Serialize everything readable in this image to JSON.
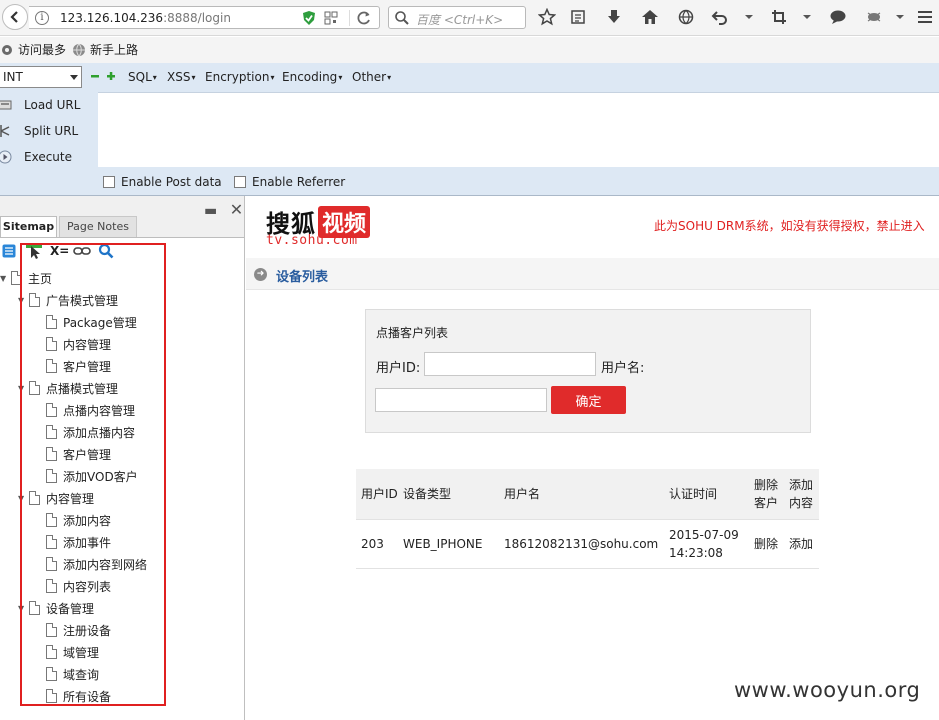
{
  "browser": {
    "url_host": "123.126.104.236",
    "url_tail": ":8888/login",
    "search_placeholder": "百度 <Ctrl+K>",
    "toolbar_icons": [
      "star-icon",
      "reading-list-icon",
      "download-icon",
      "home-icon",
      "web-icon",
      "undo-icon",
      "crop-icon",
      "chat-icon",
      "bug-icon"
    ]
  },
  "bookmarks": [
    {
      "label": "访问最多",
      "icon": "gear-icon"
    },
    {
      "label": "新手上路",
      "icon": "globe-icon"
    }
  ],
  "hackbar": {
    "select_value": "INT",
    "menus": [
      "SQL",
      "XSS",
      "Encryption",
      "Encoding",
      "Other"
    ],
    "actions": [
      "Load URL",
      "Split URL",
      "Execute"
    ],
    "options": [
      "Enable Post data",
      "Enable Referrer"
    ]
  },
  "sitemap": {
    "tabs": [
      "Sitemap",
      "Page Notes"
    ],
    "toolbar_xeq": "X=",
    "tree": [
      {
        "label": "主页",
        "level": 0,
        "expandable": true
      },
      {
        "label": "广告模式管理",
        "level": 1,
        "expandable": true
      },
      {
        "label": "Package管理",
        "level": 2,
        "expandable": false
      },
      {
        "label": "内容管理",
        "level": 2,
        "expandable": false
      },
      {
        "label": "客户管理",
        "level": 2,
        "expandable": false
      },
      {
        "label": "点播模式管理",
        "level": 1,
        "expandable": true
      },
      {
        "label": "点播内容管理",
        "level": 2,
        "expandable": false
      },
      {
        "label": "添加点播内容",
        "level": 2,
        "expandable": false
      },
      {
        "label": "客户管理",
        "level": 2,
        "expandable": false
      },
      {
        "label": "添加VOD客户",
        "level": 2,
        "expandable": false
      },
      {
        "label": "内容管理",
        "level": 1,
        "expandable": true
      },
      {
        "label": "添加内容",
        "level": 2,
        "expandable": false
      },
      {
        "label": "添加事件",
        "level": 2,
        "expandable": false
      },
      {
        "label": "添加内容到网络",
        "level": 2,
        "expandable": false
      },
      {
        "label": "内容列表",
        "level": 2,
        "expandable": false
      },
      {
        "label": "设备管理",
        "level": 1,
        "expandable": true
      },
      {
        "label": "注册设备",
        "level": 2,
        "expandable": false
      },
      {
        "label": "域管理",
        "level": 2,
        "expandable": false
      },
      {
        "label": "域查询",
        "level": 2,
        "expandable": false
      },
      {
        "label": "所有设备",
        "level": 2,
        "expandable": false
      }
    ]
  },
  "page": {
    "logo_main": "搜狐",
    "logo_video": "视频",
    "logo_domain": "tv.sohu.com",
    "drm_notice": "此为SOHU DRM系统，如没有获得授权，禁止进入",
    "section_title": "设备列表",
    "form": {
      "title": "点播客户列表",
      "user_id_label": "用户ID:",
      "user_id_value": "",
      "username_label": "用户名:",
      "username_value": "",
      "confirm_label": "确定"
    },
    "table": {
      "headers": [
        "用户ID",
        "设备类型",
        "用户名",
        "认证时间",
        "删除客户",
        "添加内容"
      ],
      "header_lines": [
        [
          "用户ID"
        ],
        [
          "设备类型"
        ],
        [
          "用户名"
        ],
        [
          "认证时间"
        ],
        [
          "删除",
          "客户"
        ],
        [
          "添加",
          "内容"
        ]
      ],
      "rows": [
        {
          "user_id": "203",
          "device_type": "WEB_IPHONE",
          "username": "18612082131@sohu.com",
          "auth_date": "2015-07-09",
          "auth_time": "14:23:08",
          "delete": "删除",
          "add": "添加"
        }
      ]
    },
    "watermark": "www.wooyun.org"
  }
}
